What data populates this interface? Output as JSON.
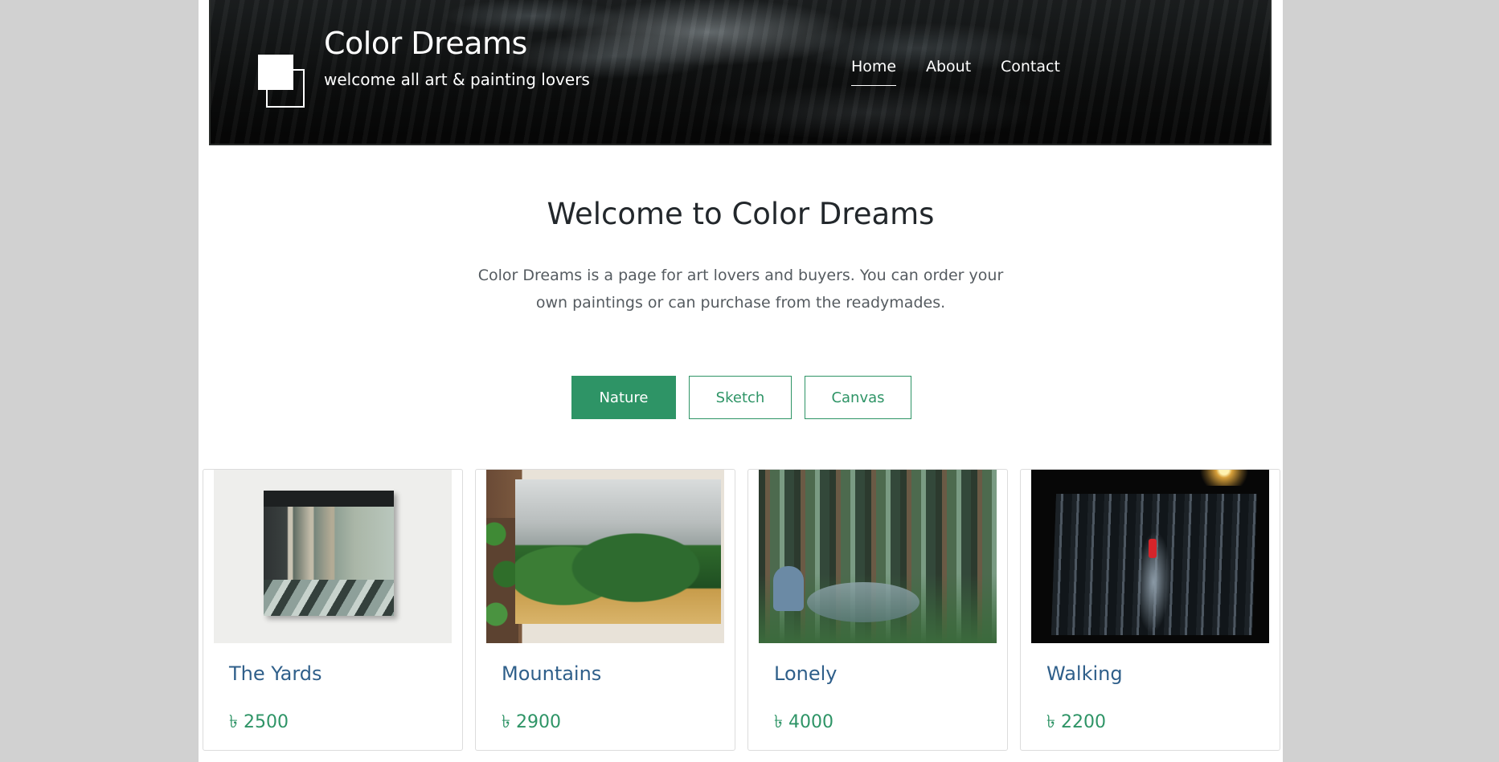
{
  "header": {
    "title": "Color Dreams",
    "subtitle": "welcome all art & painting lovers",
    "nav": [
      {
        "label": "Home",
        "active": true
      },
      {
        "label": "About",
        "active": false
      },
      {
        "label": "Contact",
        "active": false
      }
    ]
  },
  "intro": {
    "heading": "Welcome to Color Dreams",
    "text": "Color Dreams is a page for art lovers and buyers. You can order your own paintings or can purchase from the readymades."
  },
  "filters": [
    {
      "label": "Nature",
      "active": true
    },
    {
      "label": "Sketch",
      "active": false
    },
    {
      "label": "Canvas",
      "active": false
    }
  ],
  "products": [
    {
      "title": "The Yards",
      "price": "৳ 2500",
      "image": "painting-yards"
    },
    {
      "title": "Mountains",
      "price": "৳ 2900",
      "image": "painting-mountains"
    },
    {
      "title": "Lonely",
      "price": "৳ 4000",
      "image": "painting-lonely"
    },
    {
      "title": "Walking",
      "price": "৳ 2200",
      "image": "painting-walking"
    }
  ],
  "colors": {
    "accent": "#2e9466",
    "title_link": "#2f5f8a",
    "page_bg": "#d1d1d1"
  }
}
